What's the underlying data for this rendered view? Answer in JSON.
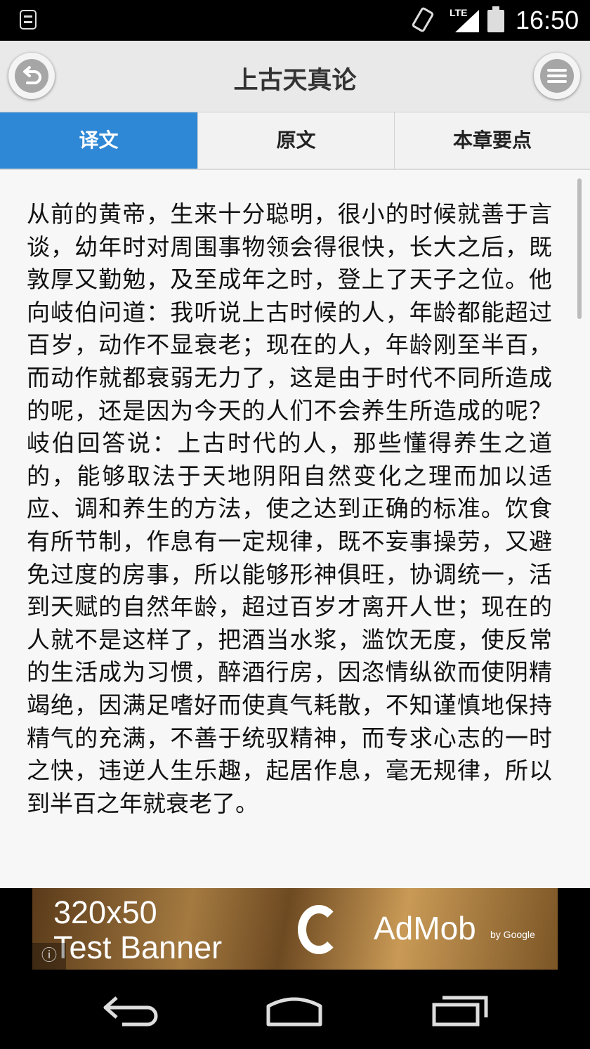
{
  "status_bar": {
    "network": "LTE",
    "time": "16:50"
  },
  "header": {
    "title": "上古天真论"
  },
  "tabs": [
    {
      "label": "译文",
      "selected": true
    },
    {
      "label": "原文",
      "selected": false
    },
    {
      "label": "本章要点",
      "selected": false
    }
  ],
  "content": {
    "text": "从前的黄帝，生来十分聪明，很小的时候就善于言谈，幼年时对周围事物领会得很快，长大之后，既敦厚又勤勉，及至成年之时，登上了天子之位。他向岐伯问道：我听说上古时候的人，年龄都能超过百岁，动作不显衰老；现在的人，年龄刚至半百，而动作就都衰弱无力了，这是由于时代不同所造成的呢，还是因为今天的人们不会养生所造成的呢？岐伯回答说：上古时代的人，那些懂得养生之道的，能够取法于天地阴阳自然变化之理而加以适应、调和养生的方法，使之达到正确的标准。饮食有所节制，作息有一定规律，既不妄事操劳，又避免过度的房事，所以能够形神俱旺，协调统一，活到天赋的自然年龄，超过百岁才离开人世；现在的人就不是这样了，把酒当水浆，滥饮无度，使反常的生活成为习惯，醉酒行房，因恣情纵欲而使阴精竭绝，因满足嗜好而使真气耗散，不知谨慎地保持精气的充满，不善于统驭精神，而专求心志的一时之快，违逆人生乐趣，起居作息，毫无规律，所以到半百之年就衰老了。"
  },
  "ad": {
    "line1": "320x50",
    "line2": "Test Banner",
    "brand": "AdMob",
    "brand_sub": "by Google",
    "info_symbol": "ⓘ"
  },
  "colors": {
    "accent": "#2f88d5",
    "header_bg": "#e9e9e9",
    "content_bg": "#f7f7f7"
  },
  "icons": {
    "back": "back-arrow-icon",
    "menu": "menu-icon",
    "nav_back": "nav-back-icon",
    "nav_home": "nav-home-icon",
    "nav_recents": "nav-recents-icon"
  }
}
